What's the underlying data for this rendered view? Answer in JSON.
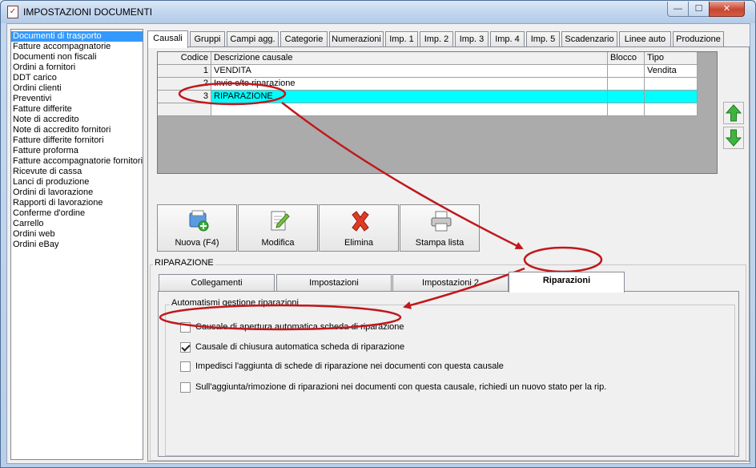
{
  "window": {
    "title": "IMPOSTAZIONI DOCUMENTI",
    "min_glyph": "—",
    "max_glyph": "☐",
    "close_glyph": "✕"
  },
  "sidebar": {
    "items": [
      "Documenti di trasporto",
      "Fatture accompagnatorie",
      "Documenti non fiscali",
      "Ordini a fornitori",
      "DDT carico",
      "Ordini clienti",
      "Preventivi",
      "Fatture differite",
      "Note di accredito",
      "Note di accredito fornitori",
      "Fatture differite fornitori",
      "Fatture proforma",
      "Fatture accompagnatorie fornitori",
      "Ricevute di cassa",
      "Lanci di produzione",
      "Ordini di lavorazione",
      "Rapporti di lavorazione",
      "Conferme d'ordine",
      "Carrello",
      "Ordini web",
      "Ordini eBay"
    ],
    "selected_index": 0
  },
  "top_tabs": [
    "Causali",
    "Gruppi",
    "Campi agg.",
    "Categorie",
    "Numerazioni",
    "Imp. 1",
    "Imp. 2",
    "Imp. 3",
    "Imp. 4",
    "Imp. 5",
    "Scadenzario",
    "Linee auto",
    "Produzione"
  ],
  "grid": {
    "columns": [
      "Codice",
      "Descrizione causale",
      "Blocco",
      "Tipo"
    ],
    "rows": [
      {
        "codice": "1",
        "descrizione": "VENDITA",
        "blocco": "",
        "tipo": "Vendita"
      },
      {
        "codice": "2",
        "descrizione": "Invio c/to riparazione",
        "blocco": "",
        "tipo": ""
      },
      {
        "codice": "3",
        "descrizione": "RIPARAZIONE",
        "blocco": "",
        "tipo": ""
      }
    ],
    "selected_row": 2
  },
  "toolbar": {
    "new_label": "Nuova (F4)",
    "edit_label": "Modifica",
    "delete_label": "Elimina",
    "print_label": "Stampa lista"
  },
  "detail": {
    "group_title": "RIPARAZIONE",
    "tabs": [
      "Collegamenti",
      "Impostazioni",
      "Impostazioni 2",
      "Riparazioni"
    ],
    "active_tab": 3,
    "auto_group_title": "Automatismi gestione riparazioni",
    "options": [
      {
        "label": "Causale di apertura automatica scheda di riparazione",
        "checked": false
      },
      {
        "label": "Causale di chiusura automatica scheda di riparazione",
        "checked": true
      },
      {
        "label": "Impedisci l'aggiunta di schede di riparazione nei documenti con questa causale",
        "checked": false
      },
      {
        "label": "Sull'aggiunta/rimozione di riparazioni nei documenti con questa causale, richiedi un nuovo stato per la rip.",
        "checked": false
      }
    ]
  },
  "colors": {
    "selection_row": "#00ffff",
    "list_selection": "#3399ff",
    "annotation": "#c0181c"
  }
}
